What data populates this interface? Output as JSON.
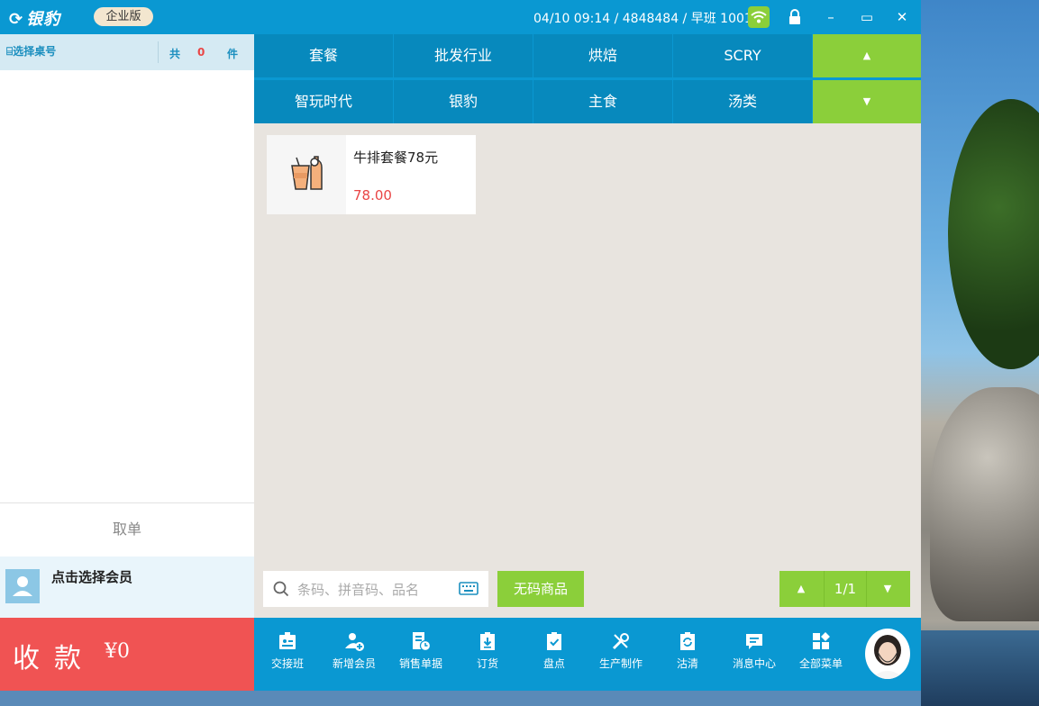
{
  "titlebar": {
    "brand": "银豹",
    "edition": "企业版",
    "status": "04/10 09:14 / 4848484 / 早班 1001",
    "minimize": "–",
    "maximize": "▭",
    "close": "✕"
  },
  "left": {
    "table_select": "选择桌号",
    "total_label": "共",
    "total_count": "0",
    "unit": "件",
    "take_order": "取单",
    "member_label": "点击选择会员",
    "pay_label": "收款",
    "pay_amount": "¥0"
  },
  "categories": {
    "row1": [
      "套餐",
      "批发行业",
      "烘焙",
      "SCRY"
    ],
    "row2": [
      "智玩时代",
      "银豹",
      "主食",
      "汤类"
    ],
    "up": "▲",
    "down": "▼"
  },
  "product": {
    "name": "牛排套餐78元",
    "price": "78.00"
  },
  "search": {
    "placeholder": "条码、拼音码、品名"
  },
  "nocode_button": "无码商品",
  "pager": {
    "up": "▲",
    "page": "1/1",
    "down": "▼"
  },
  "toolbar": {
    "items": [
      "交接班",
      "新增会员",
      "销售单据",
      "订货",
      "盘点",
      "生产制作",
      "沽清",
      "消息中心",
      "全部菜单"
    ]
  },
  "colors": {
    "primary": "#0a98d2",
    "green": "#8bcf3a",
    "red": "#f05353",
    "price": "#e94646"
  }
}
